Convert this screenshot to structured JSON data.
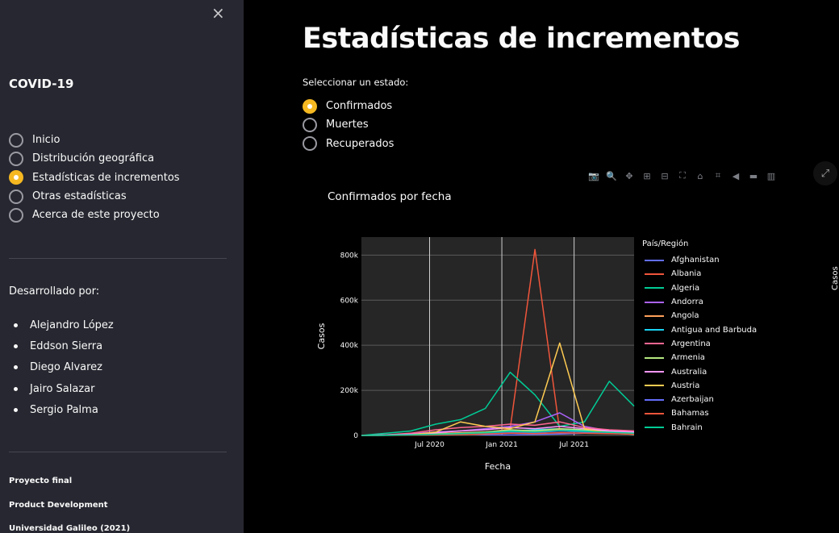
{
  "sidebar": {
    "close": "×",
    "brand": "COVID-19",
    "nav": [
      {
        "label": "Inicio",
        "selected": false
      },
      {
        "label": "Distribución geográfica",
        "selected": false
      },
      {
        "label": "Estadísticas de incrementos",
        "selected": true
      },
      {
        "label": "Otras estadísticas",
        "selected": false
      },
      {
        "label": "Acerca de este proyecto",
        "selected": false
      }
    ],
    "developed_by": "Desarrollado por:",
    "developers": [
      "Alejandro López",
      "Eddson Sierra",
      "Diego Alvarez",
      "Jairo Salazar",
      "Sergio Palma"
    ],
    "footer": [
      "Proyecto final",
      "Product Development",
      "Universidad Galileo (2021)"
    ]
  },
  "main": {
    "title": "Estadísticas de incrementos",
    "select_label": "Seleccionar un estado:",
    "options": [
      {
        "label": "Confirmados",
        "selected": true
      },
      {
        "label": "Muertes",
        "selected": false
      },
      {
        "label": "Recuperados",
        "selected": false
      }
    ],
    "side_label": "Casos"
  },
  "toolbar_icons": [
    "camera-icon",
    "zoom-icon",
    "pan-icon",
    "zoom-in-icon",
    "zoom-out-icon",
    "autoscale-icon",
    "reset-axes-icon",
    "spike-lines-icon",
    "hover-closest-icon",
    "hover-compare-icon",
    "plotly-logo-icon"
  ],
  "colors": {
    "accent": "#f5b821",
    "sidebar_bg": "#262730",
    "plot_bg": "#262626"
  },
  "chart_data": {
    "type": "line",
    "title": "Confirmados por fecha",
    "xlabel": "Fecha",
    "ylabel": "Casos",
    "x_ticks": [
      "Jul 2020",
      "Jan 2021",
      "Jul 2021"
    ],
    "y_ticks": [
      "0",
      "200k",
      "400k",
      "600k",
      "800k"
    ],
    "ylim": [
      0,
      880000
    ],
    "grid": true,
    "legend_title": "País/Región",
    "legend_position": "right",
    "series": [
      {
        "name": "Afghanistan",
        "color": "#636efa",
        "values": [
          0,
          1000,
          2000,
          5000,
          8000,
          3000,
          2000,
          4000,
          6000,
          10000,
          12000,
          5000
        ]
      },
      {
        "name": "Albania",
        "color": "#ef553b",
        "values": [
          0,
          500,
          1000,
          3000,
          6000,
          10000,
          30000,
          825000,
          20000,
          15000,
          10000,
          8000
        ]
      },
      {
        "name": "Algeria",
        "color": "#00cc96",
        "values": [
          0,
          10000,
          20000,
          50000,
          70000,
          120000,
          280000,
          180000,
          40000,
          60000,
          240000,
          130000
        ]
      },
      {
        "name": "Andorra",
        "color": "#ab63fa",
        "values": [
          0,
          2000,
          8000,
          15000,
          20000,
          30000,
          40000,
          60000,
          100000,
          40000,
          20000,
          15000
        ]
      },
      {
        "name": "Angola",
        "color": "#ffa15a",
        "values": [
          0,
          1000,
          3000,
          8000,
          12000,
          15000,
          20000,
          18000,
          25000,
          20000,
          15000,
          12000
        ]
      },
      {
        "name": "Antigua and Barbuda",
        "color": "#19d3f3",
        "values": [
          0,
          500,
          1500,
          3000,
          5000,
          10000,
          20000,
          25000,
          30000,
          20000,
          15000,
          10000
        ]
      },
      {
        "name": "Argentina",
        "color": "#ff6692",
        "values": [
          0,
          3000,
          10000,
          25000,
          35000,
          40000,
          50000,
          45000,
          60000,
          35000,
          25000,
          20000
        ]
      },
      {
        "name": "Armenia",
        "color": "#b6e880",
        "values": [
          0,
          1000,
          3000,
          6000,
          10000,
          15000,
          25000,
          20000,
          30000,
          25000,
          18000,
          12000
        ]
      },
      {
        "name": "Australia",
        "color": "#ff97ff",
        "values": [
          0,
          2000,
          5000,
          12000,
          20000,
          25000,
          35000,
          30000,
          40000,
          30000,
          20000,
          15000
        ]
      },
      {
        "name": "Austria",
        "color": "#fecb52",
        "values": [
          0,
          1000,
          3000,
          15000,
          60000,
          40000,
          30000,
          60000,
          410000,
          30000,
          10000,
          5000
        ]
      },
      {
        "name": "Azerbaijan",
        "color": "#636efa",
        "values": [
          0,
          1000,
          2000,
          4000,
          6000,
          9000,
          15000,
          12000,
          20000,
          15000,
          10000,
          8000
        ]
      },
      {
        "name": "Bahamas",
        "color": "#ef553b",
        "values": [
          0,
          500,
          1000,
          2000,
          4000,
          6000,
          10000,
          8000,
          12000,
          10000,
          8000,
          6000
        ]
      },
      {
        "name": "Bahrain",
        "color": "#00cc96",
        "values": [
          0,
          800,
          2000,
          5000,
          8000,
          12000,
          18000,
          15000,
          22000,
          18000,
          14000,
          10000
        ]
      }
    ]
  }
}
